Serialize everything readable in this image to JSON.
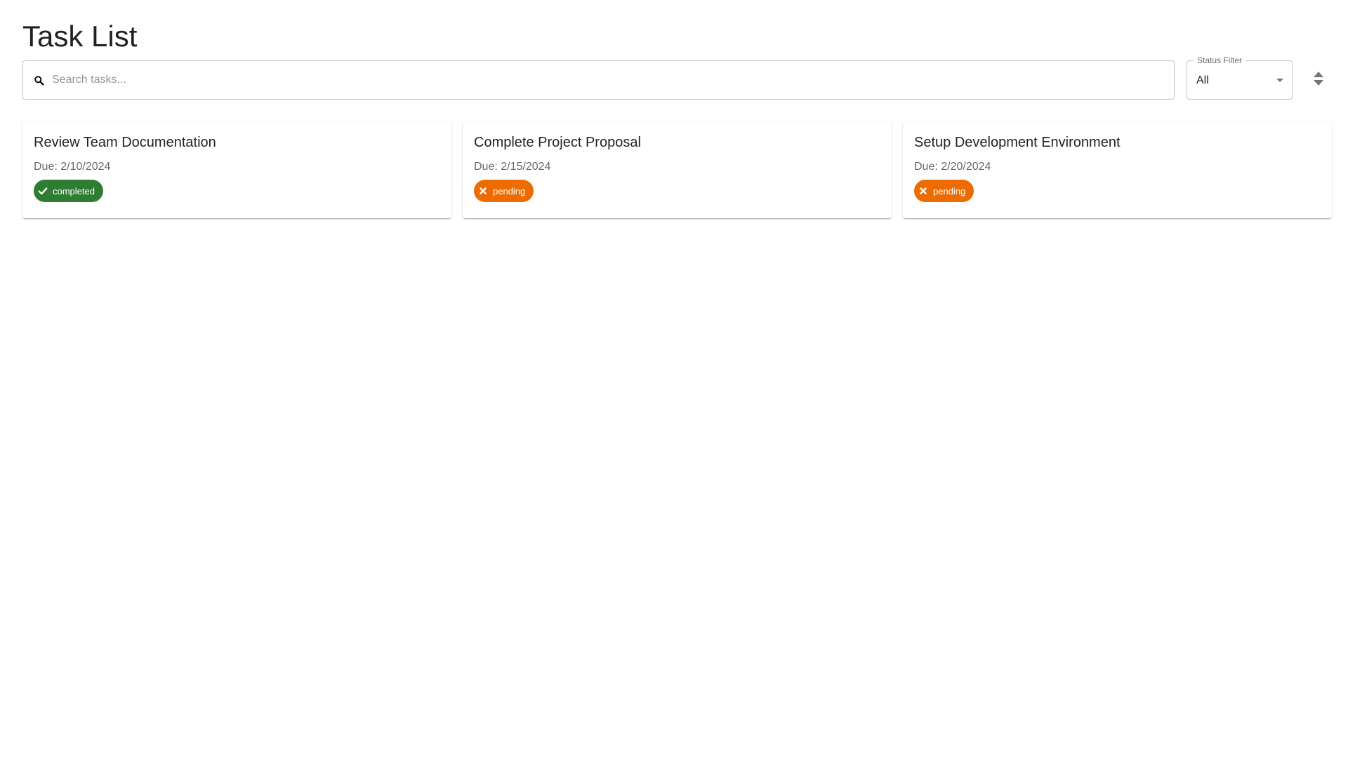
{
  "page": {
    "title": "Task List"
  },
  "search": {
    "placeholder": "Search tasks...",
    "icon": "search-icon"
  },
  "status_filter": {
    "label": "Status Filter",
    "selected": "All",
    "icon": "caret-down-icon"
  },
  "sort": {
    "icon": "sort-icon"
  },
  "colors": {
    "completed": "#2e7d32",
    "pending": "#ed6c02"
  },
  "tasks": [
    {
      "title": "Review Team Documentation",
      "due": "Due: 2/10/2024",
      "status": "completed",
      "status_icon": "check-icon"
    },
    {
      "title": "Complete Project Proposal",
      "due": "Due: 2/15/2024",
      "status": "pending",
      "status_icon": "close-icon"
    },
    {
      "title": "Setup Development Environment",
      "due": "Due: 2/20/2024",
      "status": "pending",
      "status_icon": "close-icon"
    }
  ]
}
